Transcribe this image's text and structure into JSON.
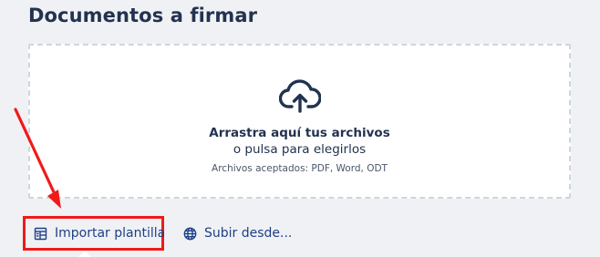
{
  "page": {
    "title": "Documentos a firmar"
  },
  "dropzone": {
    "icon": "cloud-upload-icon",
    "main_text": "Arrastra aquí tus archivos",
    "sub_text": "o pulsa para elegirlos",
    "hint": "Archivos aceptados: PDF, Word, ODT"
  },
  "actions": {
    "import_template": {
      "label": "Importar plantilla",
      "icon": "template-icon"
    },
    "upload_from": {
      "label": "Subir desde...",
      "icon": "globe-icon"
    }
  },
  "colors": {
    "background": "#eff1f5",
    "title": "#23324f",
    "link": "#1f3f84",
    "highlight": "#f01a1a"
  }
}
